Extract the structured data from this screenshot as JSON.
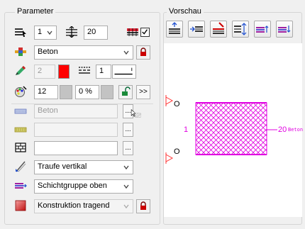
{
  "left_panel": {
    "title": "Parameter",
    "row1": {
      "count_value": "1",
      "thickness_value": "20",
      "checkbox_checked": true
    },
    "row2": {
      "material_value": "Beton"
    },
    "row3": {
      "pen_value": "2",
      "linetype_value": "1",
      "pen_color": "#ff0000"
    },
    "row4": {
      "value1": "12",
      "value2": "0 %",
      "more_label": ">>"
    },
    "row5": {
      "hatch_value": "Beton",
      "dots_label": "..."
    },
    "row6": {
      "pattern_value": "",
      "dots_label": "..."
    },
    "row7": {
      "fill_value": "",
      "dots_label": "..."
    },
    "row8": {
      "eaves_value": "Traufe vertikal"
    },
    "row9": {
      "layergroup_value": "Schichtgruppe oben"
    },
    "row10": {
      "construction_value": "Konstruktion tragend"
    }
  },
  "preview": {
    "title": "Vorschau",
    "left_label": "1",
    "right_label": "20",
    "right_material": "Beton",
    "marker_top": "O",
    "marker_bottom": "O",
    "accent_color": "#e000e0"
  }
}
